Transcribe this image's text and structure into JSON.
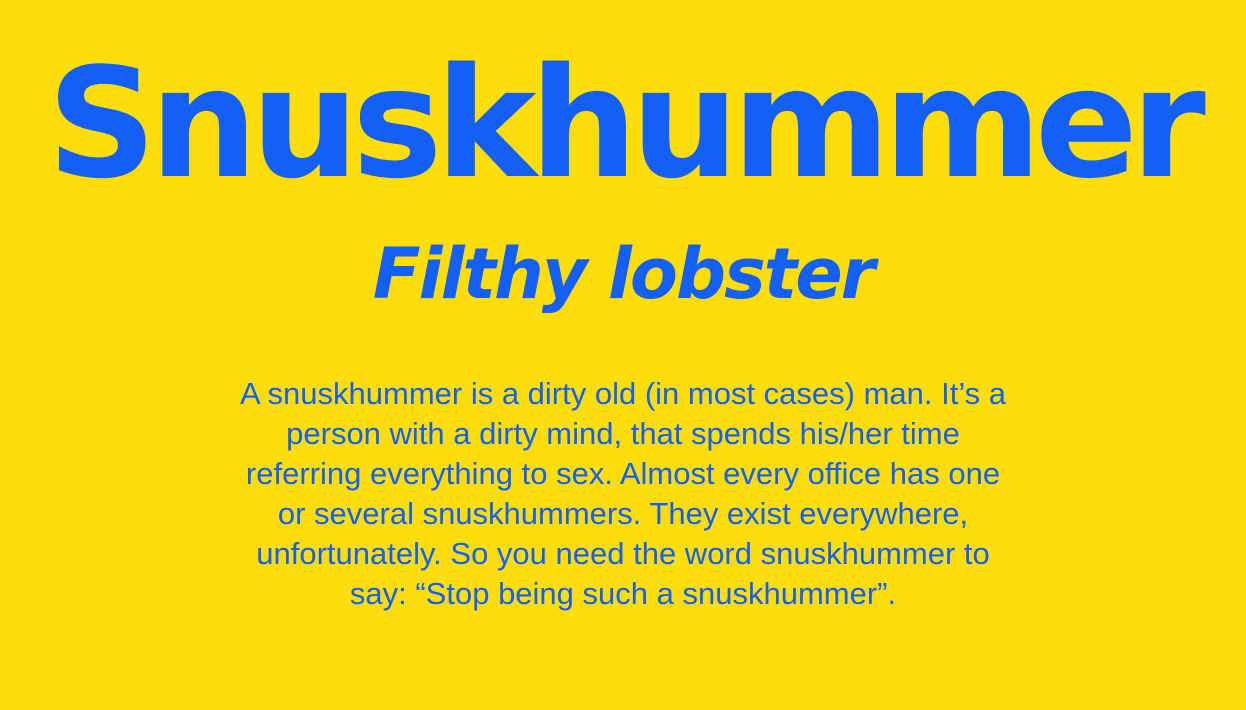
{
  "colors": {
    "background": "#FDDD0B",
    "text": "#1560F4"
  },
  "card": {
    "title": "Snuskhummer",
    "subtitle": "Filthy lobster",
    "description_lines": [
      "A snuskhummer is a dirty old (in most cases) man. It’s a",
      "person with a dirty mind, that spends his/her time",
      "referring everything to sex. Almost every office has one",
      "or several snuskhummers. They exist everywhere,",
      "unfortunately. So you need the word snuskhummer to",
      "say: “Stop being such a snuskhummer”."
    ]
  }
}
